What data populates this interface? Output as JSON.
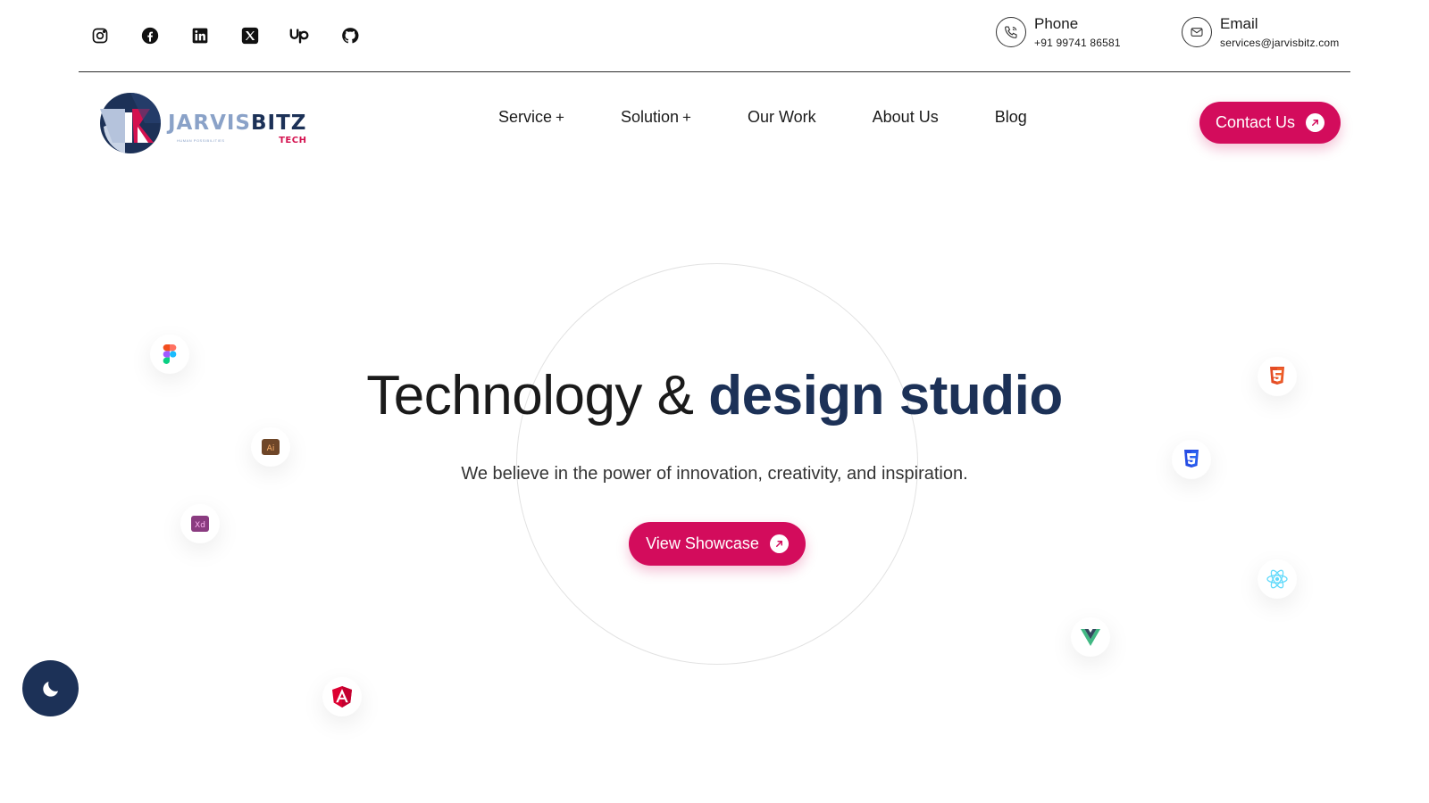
{
  "topbar": {
    "socials": [
      {
        "icon": "instagram-icon"
      },
      {
        "icon": "facebook-icon"
      },
      {
        "icon": "linkedin-icon"
      },
      {
        "icon": "x-twitter-icon"
      },
      {
        "icon": "upwork-icon"
      },
      {
        "icon": "github-icon"
      }
    ],
    "phone": {
      "label": "Phone",
      "value": "+91 99741 86581",
      "icon": "phone-icon"
    },
    "email": {
      "label": "Email",
      "value": "services@jarvisbitz.com",
      "icon": "mail-icon"
    }
  },
  "header": {
    "logo": {
      "word_a": "JARVIS",
      "word_b": "BITZ",
      "sub": "TECH",
      "tagline": "HUMAN POSSIBILITIES"
    },
    "nav": [
      {
        "label": "Service",
        "suffix": "+"
      },
      {
        "label": "Solution",
        "suffix": "+"
      },
      {
        "label": "Our Work",
        "suffix": ""
      },
      {
        "label": "About Us",
        "suffix": ""
      },
      {
        "label": "Blog",
        "suffix": ""
      }
    ],
    "cta": {
      "label": "Contact Us",
      "icon": "arrow-up-right-icon"
    }
  },
  "hero": {
    "title_plain": "Technology & ",
    "title_accent": "design studio",
    "subtitle": "We believe in the power of innovation, creativity, and inspiration.",
    "button": {
      "label": "View Showcase",
      "icon": "arrow-up-right-icon"
    }
  },
  "tech_icons": {
    "figma": {
      "icon": "figma-icon",
      "color": "#f24e1e"
    },
    "illustrator": {
      "text": "Ai",
      "icon": "illustrator-icon",
      "color": "#9a5a2e"
    },
    "xd": {
      "text": "Xd",
      "icon": "adobe-xd-icon",
      "color": "#9b3a8e"
    },
    "angular": {
      "icon": "angular-icon",
      "color": "#dd0031"
    },
    "html5": {
      "icon": "html5-icon",
      "color": "#e44d26"
    },
    "css3": {
      "icon": "css3-icon",
      "color": "#264de4"
    },
    "react": {
      "icon": "react-icon",
      "color": "#61dafb"
    },
    "vue": {
      "icon": "vue-icon",
      "color": "#41b883"
    }
  },
  "colors": {
    "accent": "#d30c5c",
    "brand_navy": "#1c3157",
    "brand_light": "#8aa2c8"
  },
  "dark_mode_toggle": {
    "icon": "moon-icon"
  }
}
